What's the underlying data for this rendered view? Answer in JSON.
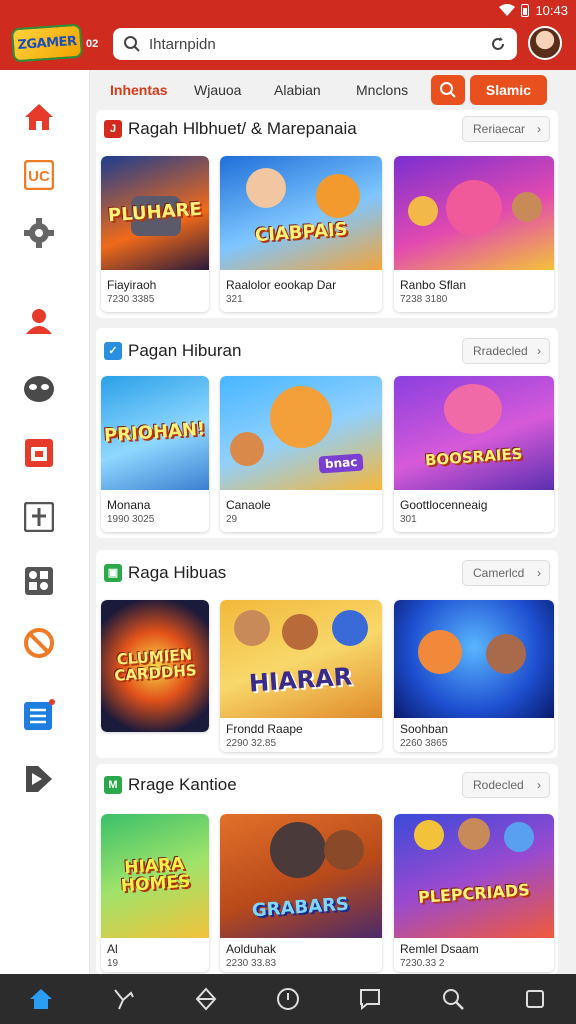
{
  "status": {
    "time": "10:43"
  },
  "header": {
    "logo_text": "ZGAMER",
    "logo_tag": "02",
    "search_placeholder": "Ihtarnpidn"
  },
  "tabs": {
    "items": [
      {
        "label": "Inhentas",
        "active": true
      },
      {
        "label": "Wjauoa",
        "active": false
      },
      {
        "label": "Alabian",
        "active": false
      },
      {
        "label": "Mnclons",
        "active": false
      }
    ],
    "cta_label": "Slamic"
  },
  "sidebar": {
    "icons": [
      "home-icon",
      "uc-icon",
      "gear-icon",
      "user-icon",
      "mask-icon",
      "calendar-icon",
      "plus-box-icon",
      "grid-icon",
      "ban-icon",
      "list-icon",
      "media-icon"
    ]
  },
  "sections": [
    {
      "title": "Ragah Hlbhuet/ & Marepanaia",
      "badge_color": "#d42a1e",
      "see_all": "Reriaecar",
      "cards": [
        {
          "thumb_text": "PLUHARE",
          "title": "Fiayiraoh",
          "meta": "7230 3385"
        },
        {
          "thumb_text": "CIABPAIS",
          "title": "Raalolor eookap Dar",
          "meta": "321"
        },
        {
          "thumb_text": "",
          "title": "Ranbo Sflan",
          "meta": "7238 3180"
        }
      ]
    },
    {
      "title": "Pagan Hiburan",
      "badge_color": "#2a8fe0",
      "see_all": "Rradecled",
      "cards": [
        {
          "thumb_text": "PRIOHAN!",
          "title": "Monana",
          "meta": "1990 3025"
        },
        {
          "thumb_text": "bnac",
          "title": "Canaole",
          "meta": "29"
        },
        {
          "thumb_text": "BOOSRAIES",
          "title": "Goottlocenneaig",
          "meta": "301"
        }
      ]
    },
    {
      "title": "Raga Hibuas",
      "badge_color": "#2aa84a",
      "see_all": "Camerlcd",
      "cards": [
        {
          "thumb_text": "CLUMIEN CARDDHS",
          "title": "",
          "meta": ""
        },
        {
          "thumb_text": "HIARAR",
          "title": "Frondd Raape",
          "meta": "2290 32.85"
        },
        {
          "thumb_text": "",
          "title": "Soohban",
          "meta": "2260 3865"
        }
      ]
    },
    {
      "title": "Rrage Kantioe",
      "badge_color": "#2aa84a",
      "see_all": "Rodecled",
      "cards": [
        {
          "thumb_text": "HIARA HOMES",
          "title": "Al",
          "meta": "19"
        },
        {
          "thumb_text": "GRABARS",
          "title": "Aolduhak",
          "meta": "2230 33.83"
        },
        {
          "thumb_text": "PLEPCRIADS",
          "title": "Remlel Dsaam",
          "meta": "7230.33 2"
        }
      ]
    }
  ],
  "bottom_nav": [
    "home-icon",
    "share-icon",
    "diamond-icon",
    "clock-icon",
    "chat-icon",
    "search-icon",
    "square-icon"
  ]
}
